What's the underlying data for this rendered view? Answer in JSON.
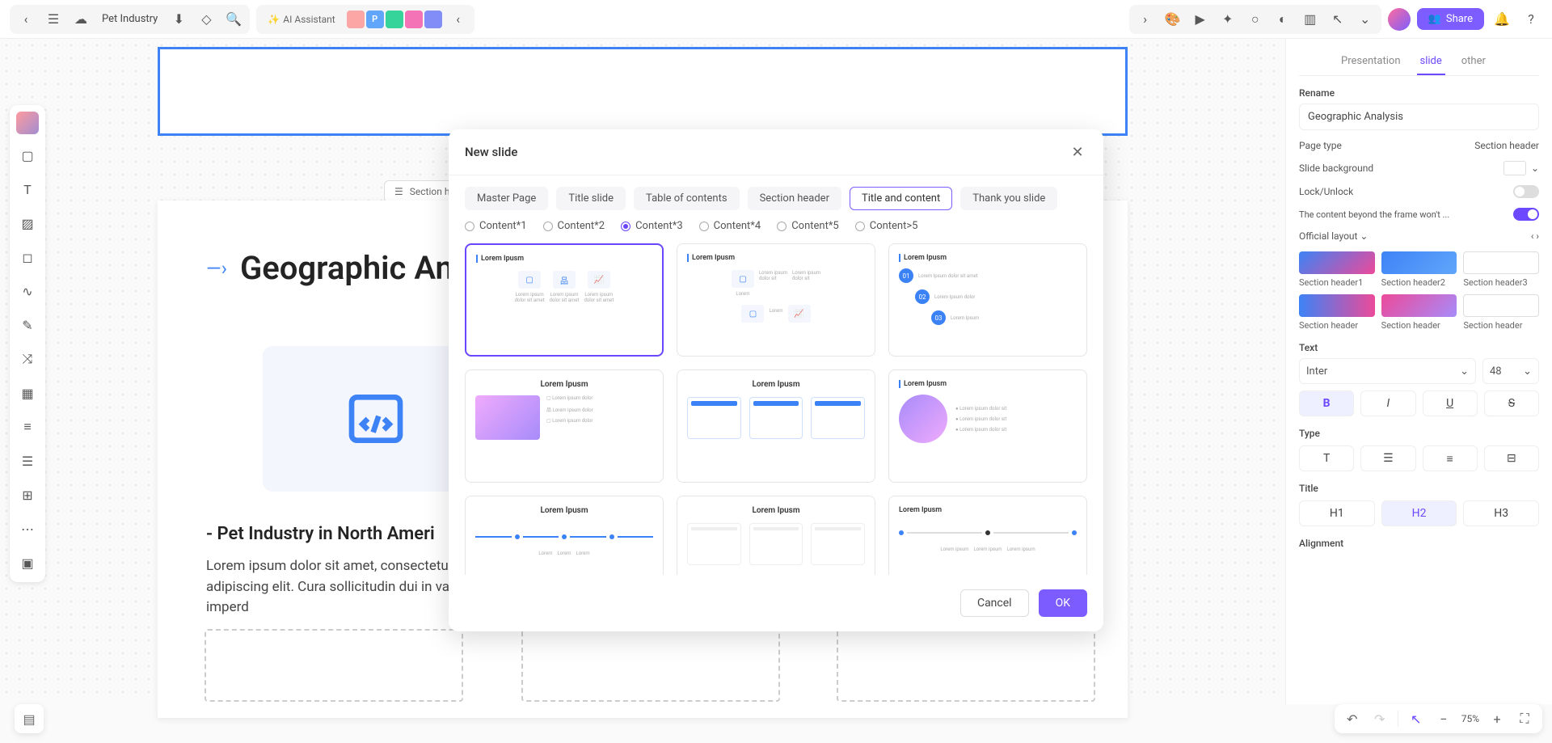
{
  "toolbar": {
    "doc_name": "Pet Industry",
    "ai_label": "AI Assistant",
    "users": [
      {
        "initial": "",
        "color": "#fca5a5"
      },
      {
        "initial": "P",
        "color": "#60a5fa"
      },
      {
        "initial": "",
        "color": "#34d399"
      },
      {
        "initial": "",
        "color": "#f472b6"
      },
      {
        "initial": "",
        "color": "#818cf8"
      }
    ],
    "share_label": "Share"
  },
  "canvas": {
    "section_label": "Section hea",
    "slide_title": "Geographic Analys",
    "subhead": "- Pet Industry in North Ameri",
    "body": "Lorem ipsum dolor sit amet, consectetur adipiscing elit. Cura sollicitudin dui in varius imperd"
  },
  "modal": {
    "title": "New slide",
    "categories": [
      "Master Page",
      "Title slide",
      "Table of contents",
      "Section header",
      "Title and content",
      "Thank you slide"
    ],
    "active_category": 4,
    "content_opts": [
      "Content*1",
      "Content*2",
      "Content*3",
      "Content*4",
      "Content*5",
      "Content>5"
    ],
    "active_content": 2,
    "tmpl_label": "Lorem Ipusm",
    "cancel": "Cancel",
    "ok": "OK"
  },
  "right": {
    "tabs": [
      "Presentation",
      "slide",
      "other"
    ],
    "active_tab": 1,
    "rename_label": "Rename",
    "rename_value": "Geographic Analysis",
    "page_type_label": "Page type",
    "page_type_value": "Section header",
    "bg_label": "Slide background",
    "lock_label": "Lock/Unlock",
    "overflow_label": "The content beyond the frame won't ...",
    "layout_label": "Official layout",
    "layouts": [
      {
        "name": "Section header1"
      },
      {
        "name": "Section header2"
      },
      {
        "name": "Section header3"
      },
      {
        "name": "Section header"
      },
      {
        "name": "Section header"
      },
      {
        "name": "Section header"
      }
    ],
    "text_label": "Text",
    "font": "Inter",
    "font_size": "48",
    "type_label": "Type",
    "title_label": "Title",
    "headings": [
      "H1",
      "H2",
      "H3"
    ],
    "align_label": "Alignment"
  },
  "bottom": {
    "zoom": "75%"
  }
}
